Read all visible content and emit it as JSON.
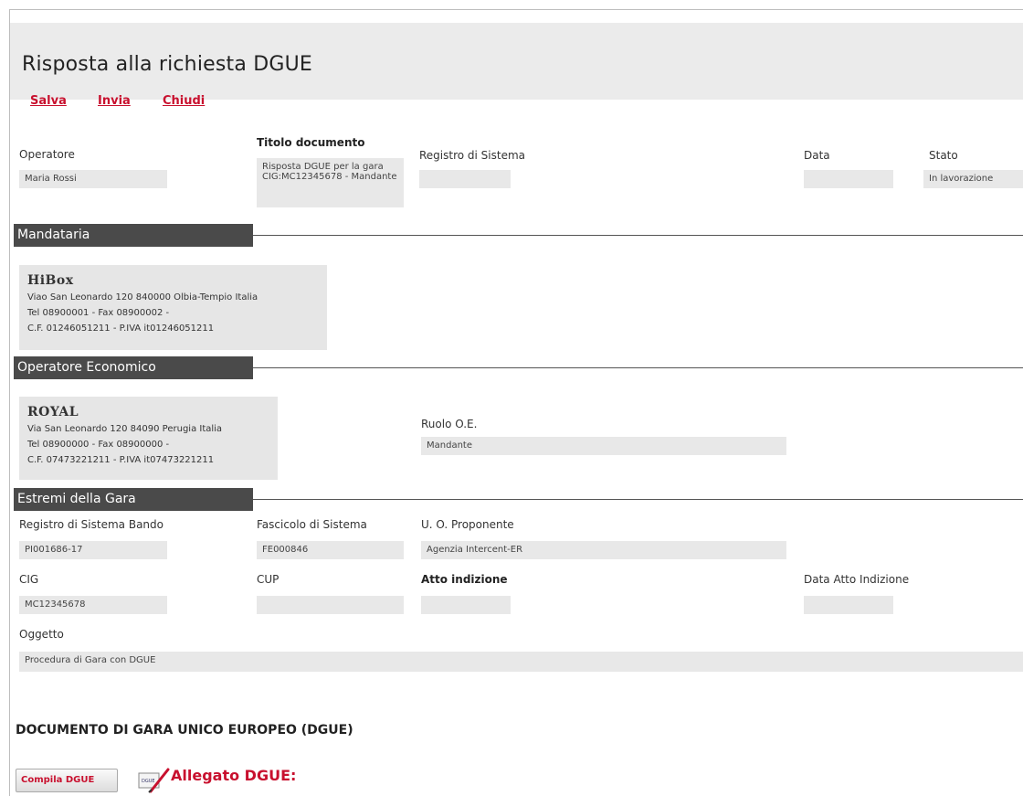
{
  "title": "Risposta alla richiesta DGUE",
  "toolbar": {
    "save": "Salva",
    "send": "Invia",
    "close": "Chiudi"
  },
  "header": {
    "operatore_label": "Operatore",
    "operatore_value": "Maria Rossi",
    "titolo_label": "Titolo documento",
    "titolo_value": "Risposta DGUE per la gara CIG:MC12345678 - Mandante",
    "registro_label": "Registro di Sistema",
    "registro_value": "",
    "data_label": "Data",
    "data_value": "",
    "stato_label": "Stato",
    "stato_value": "In lavorazione"
  },
  "mandataria": {
    "section_title": "Mandataria",
    "logo_text": "HiBox",
    "address": "Viao San Leonardo 120 840000 Olbia-Tempio Italia",
    "phone": "Tel 08900001 - Fax 08900002 -",
    "fiscal": "C.F. 01246051211 - P.IVA it01246051211"
  },
  "operatore_economico": {
    "section_title": "Operatore Economico",
    "logo_text": "ROYAL",
    "address": "Via San Leonardo 120 84090 Perugia Italia",
    "phone": "Tel 08900000 - Fax 08900000 -",
    "fiscal": "C.F. 07473221211 - P.IVA it07473221211",
    "ruolo_label": "Ruolo O.E.",
    "ruolo_value": "Mandante"
  },
  "gara": {
    "section_title": "Estremi della Gara",
    "registro_bando_label": "Registro di Sistema Bando",
    "registro_bando_value": "PI001686-17",
    "fascicolo_label": "Fascicolo di Sistema",
    "fascicolo_value": "FE000846",
    "uo_label": "U. O. Proponente",
    "uo_value": "Agenzia Intercent-ER",
    "cig_label": "CIG",
    "cig_value": "MC12345678",
    "cup_label": "CUP",
    "cup_value": "",
    "atto_label": "Atto indizione",
    "atto_value": "",
    "data_atto_label": "Data Atto Indizione",
    "data_atto_value": "",
    "oggetto_label": "Oggetto",
    "oggetto_value": "Procedura di Gara con DGUE"
  },
  "dgue": {
    "title": "DOCUMENTO DI GARA UNICO EUROPEO (DGUE)",
    "compila_button": "Compila DGUE",
    "allegato_label": "Allegato DGUE:",
    "icon": "signed-document-icon"
  },
  "colors": {
    "accent_red": "#c8102e",
    "section_bar": "#4a4a4a",
    "field_bg": "#e8e8e8"
  }
}
